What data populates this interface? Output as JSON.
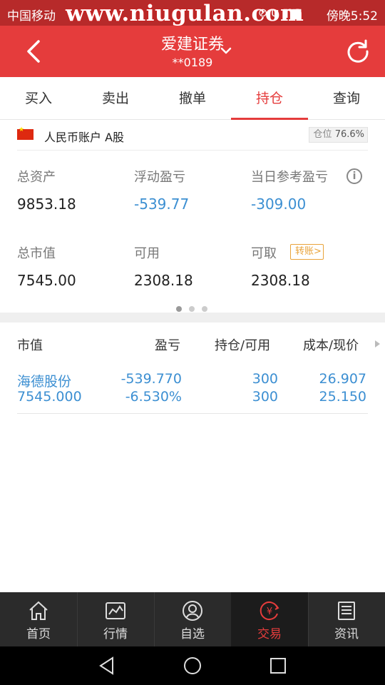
{
  "status_bar": {
    "carrier": "中国移动",
    "watermark": "www.niugulan.com",
    "clock": "傍晚5:52",
    "sys_icons": "⊘ ψ ▮ ▆"
  },
  "header": {
    "title": "爱建证券",
    "account_no": "**0189",
    "back_icon": "back-chevron",
    "dropdown_icon": "chevron-down",
    "refresh_icon": "refresh"
  },
  "tabs": [
    {
      "label": "买入",
      "active": false
    },
    {
      "label": "卖出",
      "active": false
    },
    {
      "label": "撤单",
      "active": false
    },
    {
      "label": "持仓",
      "active": true
    },
    {
      "label": "查询",
      "active": false
    }
  ],
  "account": {
    "label": "人民币账户 A股",
    "position_label": "仓位",
    "position_value": "76.6%"
  },
  "stats": {
    "total_assets": {
      "label": "总资产",
      "value": "9853.18"
    },
    "floating_pnl": {
      "label": "浮动盈亏",
      "value": "-539.77"
    },
    "today_pnl": {
      "label": "当日参考盈亏",
      "value": "-309.00"
    },
    "market_value": {
      "label": "总市值",
      "value": "7545.00"
    },
    "available": {
      "label": "可用",
      "value": "2308.18"
    },
    "withdrawable": {
      "label": "可取",
      "value": "2308.18"
    },
    "transfer_label": "转账"
  },
  "pager": {
    "total": 3,
    "active": 0
  },
  "holdings": {
    "headers": [
      "市值",
      "盈亏",
      "持仓/可用",
      "成本/现价"
    ],
    "rows": [
      {
        "name": "海德股份",
        "market_value": "7545.000",
        "pnl": "-539.770",
        "pnl_pct": "-6.530%",
        "position": "300",
        "available": "300",
        "cost": "26.907",
        "price": "25.150"
      }
    ]
  },
  "bottom_nav": [
    {
      "label": "首页",
      "icon": "home-icon",
      "active": false
    },
    {
      "label": "行情",
      "icon": "chart-icon",
      "active": false
    },
    {
      "label": "自选",
      "icon": "user-icon",
      "active": false
    },
    {
      "label": "交易",
      "icon": "yuan-icon",
      "active": true
    },
    {
      "label": "资讯",
      "icon": "news-icon",
      "active": false
    }
  ],
  "colors": {
    "brand_red": "#e53c3c",
    "statusbar_red": "#b72a2a",
    "value_blue": "#3c8fd2",
    "transfer_orange": "#e9a33a"
  }
}
